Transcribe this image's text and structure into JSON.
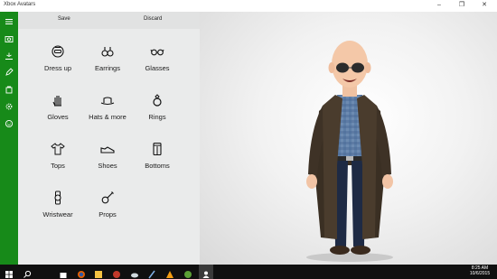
{
  "window": {
    "title": "Xbox Avatars",
    "minimize_glyph": "–",
    "maximize_glyph": "❐",
    "close_glyph": "✕"
  },
  "rail": {
    "items": [
      {
        "icon": "hamburger-icon"
      },
      {
        "icon": "camera-icon"
      },
      {
        "icon": "body-icon"
      },
      {
        "icon": "pencil-icon"
      },
      {
        "icon": "bag-icon"
      },
      {
        "icon": "gear-icon"
      },
      {
        "icon": "smiley-icon"
      }
    ],
    "color": "#178a19"
  },
  "commands": {
    "save_label": "Save",
    "discard_label": "Discard"
  },
  "categories": [
    {
      "label": "Dress up",
      "icon": "dress-up-icon"
    },
    {
      "label": "Earrings",
      "icon": "earrings-icon"
    },
    {
      "label": "Glasses",
      "icon": "glasses-icon"
    },
    {
      "label": "Gloves",
      "icon": "gloves-icon"
    },
    {
      "label": "Hats & more",
      "icon": "hat-icon"
    },
    {
      "label": "Rings",
      "icon": "ring-icon"
    },
    {
      "label": "Tops",
      "icon": "tops-icon"
    },
    {
      "label": "Shoes",
      "icon": "shoes-icon"
    },
    {
      "label": "Bottoms",
      "icon": "bottoms-icon"
    },
    {
      "label": "Wristwear",
      "icon": "watch-icon"
    },
    {
      "label": "Props",
      "icon": "guitar-icon"
    }
  ],
  "taskbar": {
    "time": "8:25 AM",
    "date": "10/6/2015",
    "icons": [
      "start-icon",
      "search-icon",
      "store-icon",
      "firefox-icon",
      "app-icon",
      "cloud-icon",
      "paint-icon",
      "vlc-icon",
      "photos-icon",
      "edge-icon",
      "explorer-icon",
      "utorrent-icon",
      "avatar-app-icon"
    ]
  }
}
